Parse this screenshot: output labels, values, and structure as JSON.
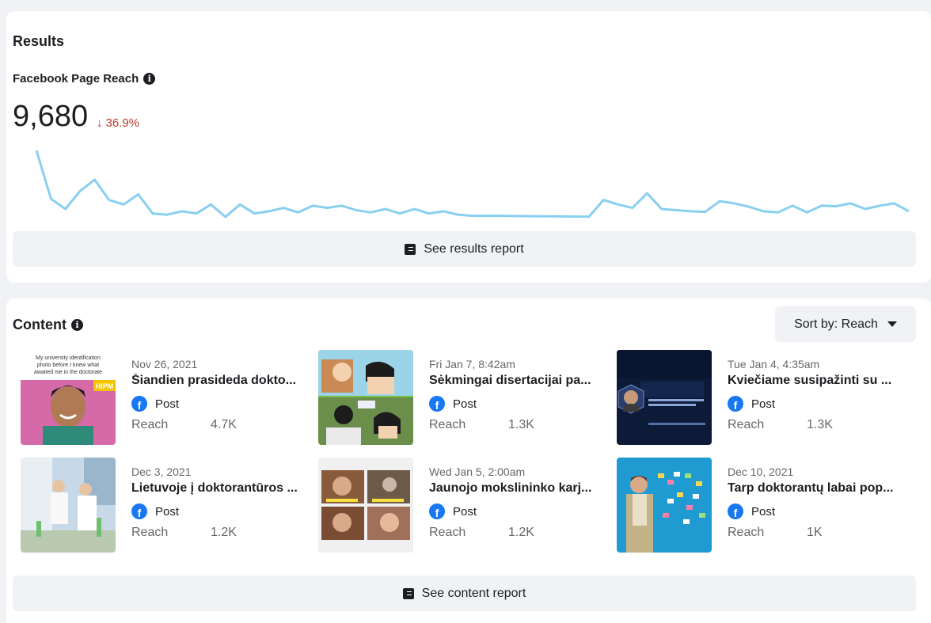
{
  "results": {
    "title": "Results",
    "metric_label": "Facebook Page Reach",
    "value": "9,680",
    "change": "36.9%",
    "change_direction": "down",
    "report_button": "See results report",
    "colors": {
      "line": "#89cff0",
      "negative": "#c0392b"
    }
  },
  "chart_data": {
    "type": "line",
    "series": [
      {
        "values": [
          1000,
          570,
          480,
          640,
          740,
          560,
          520,
          610,
          440,
          430,
          460,
          440,
          520,
          410,
          520,
          440,
          460,
          490,
          450,
          510,
          490,
          510,
          470,
          450,
          480,
          440,
          480,
          440,
          460,
          430,
          420,
          420,
          420,
          418,
          416,
          415,
          414,
          413,
          412,
          560,
          520,
          490,
          620,
          480,
          470,
          460,
          455,
          550,
          530,
          500,
          460,
          450,
          510,
          450,
          510,
          505,
          530,
          480,
          510,
          530,
          460
        ]
      }
    ]
  },
  "content": {
    "title": "Content",
    "sort_label": "Sort by: Reach",
    "report_button": "See content report",
    "reach_label": "Reach",
    "posts": [
      {
        "date": "Nov 26, 2021",
        "title": "Šiandien prasideda dokto...",
        "type": "Post",
        "reach": "4.7K",
        "thumb_text": "My university identification photo before I knew what awaited me in the doctorate",
        "thumb_logo": "HIPM"
      },
      {
        "date": "Fri Jan 7, 8:42am",
        "title": "Sėkmingai disertacijai pa...",
        "type": "Post",
        "reach": "1.3K"
      },
      {
        "date": "Tue Jan 4, 4:35am",
        "title": "Kviečiame susipažinti su ...",
        "type": "Post",
        "reach": "1.3K"
      },
      {
        "date": "Dec 3, 2021",
        "title": "Lietuvoje į doktorantūros ...",
        "type": "Post",
        "reach": "1.2K"
      },
      {
        "date": "Wed Jan 5, 2:00am",
        "title": "Jaunojo mokslininko karj...",
        "type": "Post",
        "reach": "1.2K"
      },
      {
        "date": "Dec 10, 2021",
        "title": "Tarp doktorantų labai pop...",
        "type": "Post",
        "reach": "1K"
      }
    ]
  }
}
